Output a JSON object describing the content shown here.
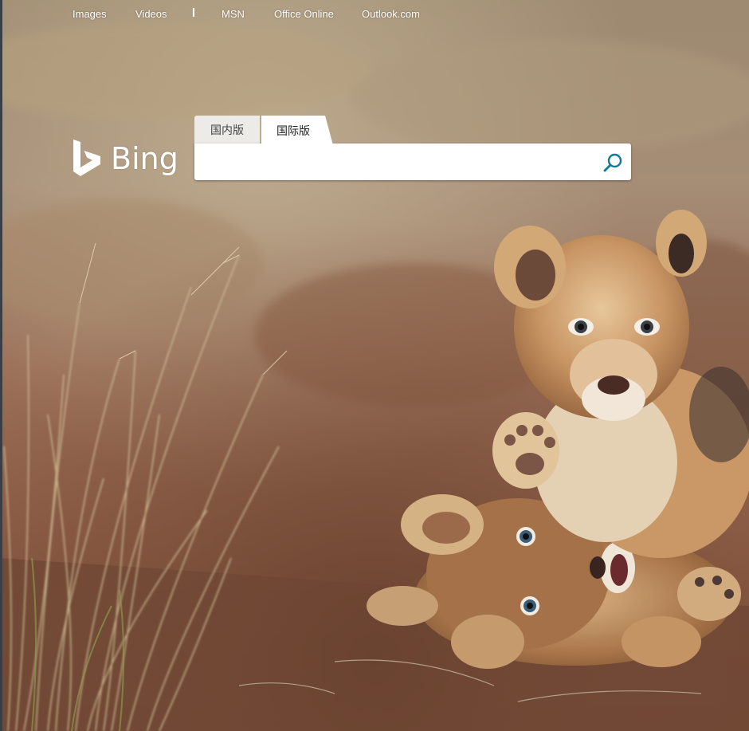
{
  "nav": {
    "links": [
      "Images",
      "Videos",
      "MSN",
      "Office Online",
      "Outlook.com"
    ]
  },
  "logo": {
    "text": "Bing",
    "icon": "bing-b-icon"
  },
  "tabs": {
    "domestic": "国内版",
    "international": "国际版",
    "selected": "international"
  },
  "search": {
    "value": "",
    "placeholder": "",
    "button_icon": "search-icon"
  },
  "colors": {
    "accent": "#0c7b93",
    "tab_inactive": "#ecebe8",
    "text_white": "#ffffff"
  }
}
